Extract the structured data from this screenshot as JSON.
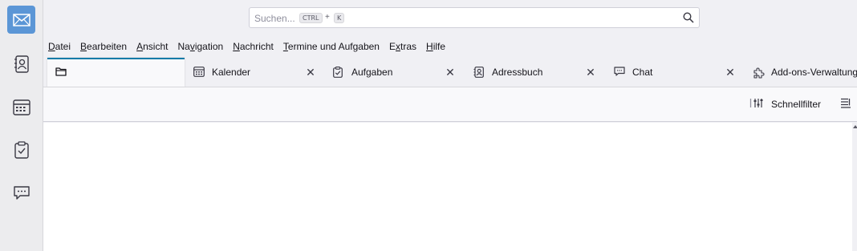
{
  "spaces": {
    "mail": "envelope-icon",
    "addressbook": "addressbook-icon",
    "calendar": "calendar-icon",
    "tasks": "clipboard-icon",
    "chat": "chat-icon",
    "accent": "#5b96d6"
  },
  "search": {
    "placeholder": "Suchen...",
    "shortcut_key1": "CTRL",
    "shortcut_plus": "+",
    "shortcut_key2": "K"
  },
  "menubar": {
    "items": [
      {
        "pre": "",
        "ul": "D",
        "post": "atei"
      },
      {
        "pre": "",
        "ul": "B",
        "post": "earbeiten"
      },
      {
        "pre": "",
        "ul": "A",
        "post": "nsicht"
      },
      {
        "pre": "Na",
        "ul": "v",
        "post": "igation"
      },
      {
        "pre": "",
        "ul": "N",
        "post": "achricht"
      },
      {
        "pre": "",
        "ul": "T",
        "post": "ermine und Aufgaben"
      },
      {
        "pre": "E",
        "ul": "x",
        "post": "tras"
      },
      {
        "pre": "",
        "ul": "H",
        "post": "ilfe"
      }
    ]
  },
  "tabs": [
    {
      "label": "",
      "icon": "folder-icon"
    },
    {
      "label": "Kalender",
      "icon": "calendar-icon",
      "close": "✕"
    },
    {
      "label": "Aufgaben",
      "icon": "clipboard-icon",
      "close": "✕"
    },
    {
      "label": "Adressbuch",
      "icon": "addressbook-icon",
      "close": "✕"
    },
    {
      "label": "Chat",
      "icon": "chat-icon",
      "close": "✕"
    },
    {
      "label": "Add-ons-Verwaltung",
      "icon": "puzzle-icon"
    }
  ],
  "toolbar": {
    "quickfilter_label": "Schnellfilter"
  },
  "colors": {
    "selected_tab_border": "#0f7ba8"
  }
}
